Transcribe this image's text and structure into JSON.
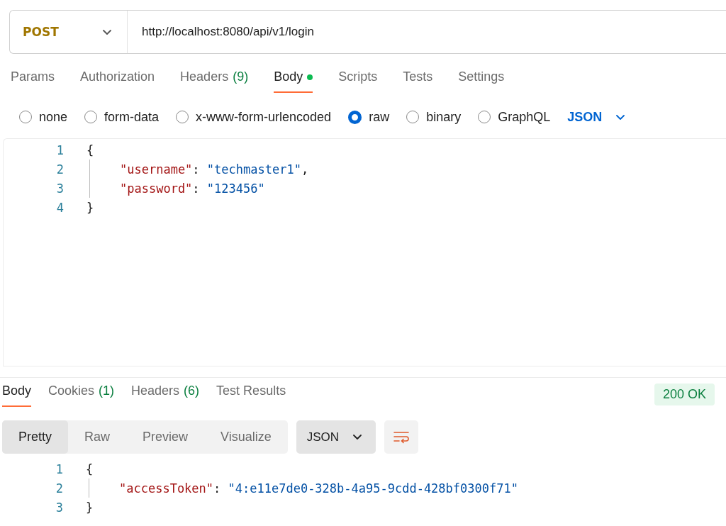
{
  "request": {
    "method": "POST",
    "url": "http://localhost:8080/api/v1/login"
  },
  "request_tabs": [
    {
      "label": "Params",
      "selected": false,
      "dot": false
    },
    {
      "label": "Authorization",
      "selected": false,
      "dot": false
    },
    {
      "label": "Headers",
      "count": "(9)",
      "selected": false,
      "dot": false
    },
    {
      "label": "Body",
      "selected": true,
      "dot": true
    },
    {
      "label": "Scripts",
      "selected": false,
      "dot": false
    },
    {
      "label": "Tests",
      "selected": false,
      "dot": false
    },
    {
      "label": "Settings",
      "selected": false,
      "dot": false
    }
  ],
  "body_types": [
    {
      "label": "none",
      "selected": false
    },
    {
      "label": "form-data",
      "selected": false
    },
    {
      "label": "x-www-form-urlencoded",
      "selected": false
    },
    {
      "label": "raw",
      "selected": true
    },
    {
      "label": "binary",
      "selected": false
    },
    {
      "label": "GraphQL",
      "selected": false
    }
  ],
  "body_format": "JSON",
  "request_body": [
    {
      "number": "1",
      "indented": false,
      "tokens": [
        {
          "kind": "punct",
          "text": "{"
        }
      ]
    },
    {
      "number": "2",
      "indented": true,
      "tokens": [
        {
          "kind": "key",
          "text": "\"username\""
        },
        {
          "kind": "punct",
          "text": ": "
        },
        {
          "kind": "string",
          "text": "\"techmaster1\""
        },
        {
          "kind": "punct",
          "text": ","
        }
      ]
    },
    {
      "number": "3",
      "indented": true,
      "tokens": [
        {
          "kind": "key",
          "text": "\"password\""
        },
        {
          "kind": "punct",
          "text": ": "
        },
        {
          "kind": "string",
          "text": "\"123456\""
        }
      ]
    },
    {
      "number": "4",
      "indented": false,
      "tokens": [
        {
          "kind": "punct",
          "text": "}"
        }
      ]
    }
  ],
  "response_tabs": [
    {
      "label": "Body",
      "selected": true
    },
    {
      "label": "Cookies",
      "count": "(1)",
      "selected": false
    },
    {
      "label": "Headers",
      "count": "(6)",
      "selected": false
    },
    {
      "label": "Test Results",
      "selected": false
    }
  ],
  "status": "200 OK",
  "view_modes": [
    {
      "label": "Pretty",
      "selected": true
    },
    {
      "label": "Raw",
      "selected": false
    },
    {
      "label": "Preview",
      "selected": false
    },
    {
      "label": "Visualize",
      "selected": false
    }
  ],
  "response_format": "JSON",
  "response_body": [
    {
      "number": "1",
      "indented": false,
      "tokens": [
        {
          "kind": "punct",
          "text": "{"
        }
      ]
    },
    {
      "number": "2",
      "indented": true,
      "tokens": [
        {
          "kind": "key",
          "text": "\"accessToken\""
        },
        {
          "kind": "punct",
          "text": ": "
        },
        {
          "kind": "string",
          "text": "\"4:e11e7de0-328b-4a95-9cdd-428bf0300f71\""
        }
      ]
    },
    {
      "number": "3",
      "indented": false,
      "tokens": [
        {
          "kind": "punct",
          "text": "}"
        }
      ]
    }
  ]
}
